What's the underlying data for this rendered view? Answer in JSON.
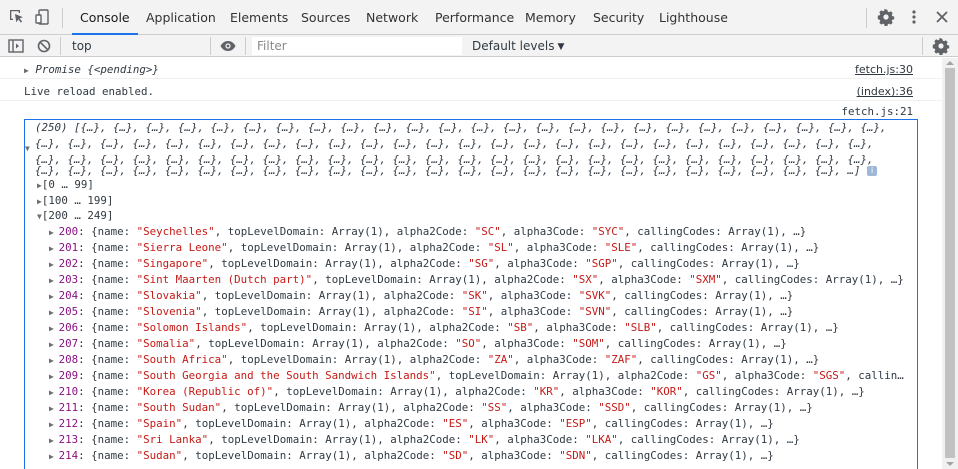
{
  "tabs": [
    {
      "label": "Console",
      "active": true
    },
    {
      "label": "Application"
    },
    {
      "label": "Elements"
    },
    {
      "label": "Sources"
    },
    {
      "label": "Network"
    },
    {
      "label": "Performance"
    },
    {
      "label": "Memory"
    },
    {
      "label": "Security"
    },
    {
      "label": "Lighthouse"
    }
  ],
  "toolbar": {
    "context": "top",
    "filter_placeholder": "Filter",
    "levels_label": "Default levels",
    "levels_caret": "▼"
  },
  "messages": [
    {
      "text": "Promise {<pending>}",
      "source": "fetch.js:30"
    },
    {
      "text": "Live reload enabled.",
      "source": "(index):36"
    },
    {
      "text": "",
      "source": "fetch.js:21"
    }
  ],
  "array_preview": {
    "lines": [
      "(250) [{…}, {…}, {…}, {…}, {…}, {…}, {…}, {…}, {…}, {…}, {…}, {…}, {…}, {…}, {…}, {…}, {…}, {…}, {…}, {…}, {…}, {…}, {…}, {…}, {…},",
      "{…}, {…}, {…}, {…}, {…}, {…}, {…}, {…}, {…}, {…}, {…}, {…}, {…}, {…}, {…}, {…}, {…}, {…}, {…}, {…}, {…}, {…}, {…}, {…}, {…}, {…},",
      "{…}, {…}, {…}, {…}, {…}, {…}, {…}, {…}, {…}, {…}, {…}, {…}, {…}, {…}, {…}, {…}, {…}, {…}, {…}, {…}, {…}, {…}, {…}, {…}, {…}, {…},",
      "{…}, {…}, {…}, {…}, {…}, {…}, {…}, {…}, {…}, {…}, {…}, {…}, {…}, {…}, {…}, {…}, {…}, {…}, {…}, {…}, {…}, {…}, {…}, {…}, {…}, …]"
    ],
    "info_icon": "i"
  },
  "groups": [
    {
      "label": "[0 … 99]",
      "expanded": false
    },
    {
      "label": "[100 … 199]",
      "expanded": false
    },
    {
      "label": "[200 … 249]",
      "expanded": true
    }
  ],
  "rows": [
    {
      "index": "200",
      "name": "\"Seychelles\"",
      "alpha2": "\"SC\"",
      "alpha3": "\"SYC\"",
      "tail": ", callingCodes: Array(1), …}"
    },
    {
      "index": "201",
      "name": "\"Sierra Leone\"",
      "alpha2": "\"SL\"",
      "alpha3": "\"SLE\"",
      "tail": ", callingCodes: Array(1), …}"
    },
    {
      "index": "202",
      "name": "\"Singapore\"",
      "alpha2": "\"SG\"",
      "alpha3": "\"SGP\"",
      "tail": ", callingCodes: Array(1), …}"
    },
    {
      "index": "203",
      "name": "\"Sint Maarten (Dutch part)\"",
      "alpha2": "\"SX\"",
      "alpha3": "\"SXM\"",
      "tail": ", callingCodes: Array(1), …}"
    },
    {
      "index": "204",
      "name": "\"Slovakia\"",
      "alpha2": "\"SK\"",
      "alpha3": "\"SVK\"",
      "tail": ", callingCodes: Array(1), …}"
    },
    {
      "index": "205",
      "name": "\"Slovenia\"",
      "alpha2": "\"SI\"",
      "alpha3": "\"SVN\"",
      "tail": ", callingCodes: Array(1), …}"
    },
    {
      "index": "206",
      "name": "\"Solomon Islands\"",
      "alpha2": "\"SB\"",
      "alpha3": "\"SLB\"",
      "tail": ", callingCodes: Array(1), …}"
    },
    {
      "index": "207",
      "name": "\"Somalia\"",
      "alpha2": "\"SO\"",
      "alpha3": "\"SOM\"",
      "tail": ", callingCodes: Array(1), …}"
    },
    {
      "index": "208",
      "name": "\"South Africa\"",
      "alpha2": "\"ZA\"",
      "alpha3": "\"ZAF\"",
      "tail": ", callingCodes: Array(1), …}"
    },
    {
      "index": "209",
      "name": "\"South Georgia and the South Sandwich Islands\"",
      "alpha2": "\"GS\"",
      "alpha3": "\"SGS\"",
      "tail": ", callin…"
    },
    {
      "index": "210",
      "name": "\"Korea (Republic of)\"",
      "alpha2": "\"KR\"",
      "alpha3": "\"KOR\"",
      "tail": ", callingCodes: Array(1), …}"
    },
    {
      "index": "211",
      "name": "\"South Sudan\"",
      "alpha2": "\"SS\"",
      "alpha3": "\"SSD\"",
      "tail": ", callingCodes: Array(1), …}"
    },
    {
      "index": "212",
      "name": "\"Spain\"",
      "alpha2": "\"ES\"",
      "alpha3": "\"ESP\"",
      "tail": ", callingCodes: Array(1), …}"
    },
    {
      "index": "213",
      "name": "\"Sri Lanka\"",
      "alpha2": "\"LK\"",
      "alpha3": "\"LKA\"",
      "tail": ", callingCodes: Array(1), …}"
    },
    {
      "index": "214",
      "name": "\"Sudan\"",
      "alpha2": "\"SD\"",
      "alpha3": "\"SDN\"",
      "tail": ", callingCodes: Array(1), …}"
    }
  ],
  "row_labels": {
    "open": ": {name: ",
    "tld": ", topLevelDomain: Array(1), alpha2Code: ",
    "a3": ", alpha3Code: "
  },
  "colors": {
    "accent": "#1a73e8",
    "index": "#881280",
    "string": "#c41a16"
  }
}
